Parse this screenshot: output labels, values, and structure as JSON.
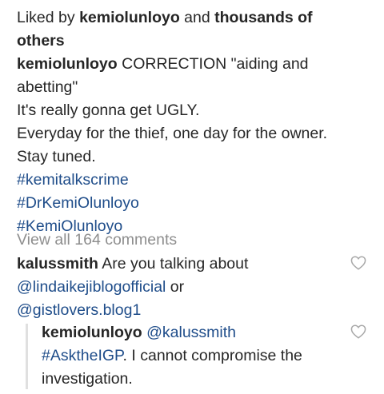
{
  "likes": {
    "prefix": "Liked by ",
    "user": "kemiolunloyo",
    "and": " and ",
    "others_line1": "thousands of",
    "others_line2": "others"
  },
  "caption": {
    "username": "kemiolunloyo",
    "line1_text": " CORRECTION \"aiding and",
    "line2": "abetting\"",
    "line3": "It's really gonna get UGLY.",
    "line4": "Everyday for the thief, one day for the owner.",
    "line5": "Stay tuned.",
    "hashtags": [
      "#kemitalkscrime",
      "#DrKemiOlunloyo",
      "#KemiOlunloyo"
    ]
  },
  "view_all_comments": "View all 164 comments",
  "comments": [
    {
      "username": "kalussmith",
      "line1_text": " Are you talking about",
      "mention1": "@lindaikejiblogofficial",
      "or": " or",
      "mention2": "@gistlovers.blog1",
      "icon": "heart-outline-icon"
    },
    {
      "username": "kemiolunloyo",
      "mention": "@kalussmith",
      "hashtag": "#AsktheIGP",
      "line2_text": ". I cannot compromise the",
      "line3": "investigation.",
      "icon": "heart-outline-icon"
    }
  ],
  "colors": {
    "text": "#262626",
    "link": "#1f4d8a",
    "muted": "#8e8e8e",
    "icon": "#a8a8a8"
  }
}
